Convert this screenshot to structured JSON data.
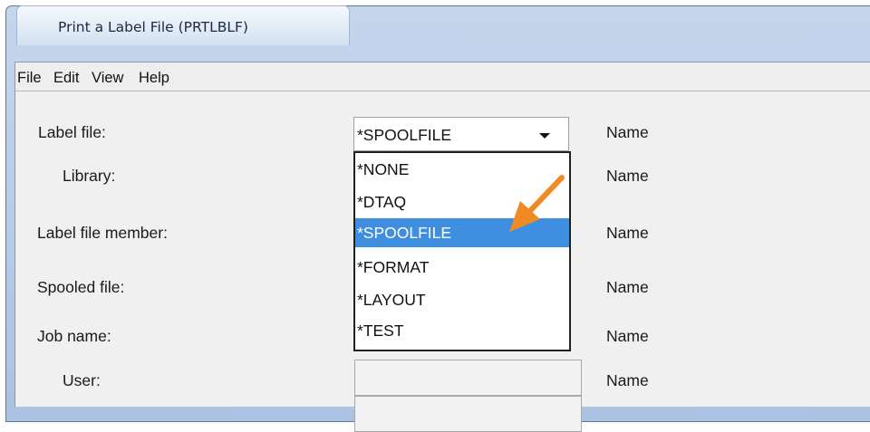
{
  "window": {
    "title": "Print a Label File (PRTLBLF)"
  },
  "menu": {
    "items": [
      "File",
      "Edit",
      "View",
      "Help"
    ]
  },
  "form": {
    "label_file": "Label file:",
    "library": "Library:",
    "label_file_member": "Label file member:",
    "spooled_file": "Spooled file:",
    "job_name": "Job name:",
    "user": "User:",
    "name_hint": "Name"
  },
  "combo": {
    "value": "*SPOOLFILE"
  },
  "dropdown": {
    "options": [
      "*NONE",
      "*DTAQ",
      "*SPOOLFILE",
      "*FORMAT",
      "*LAYOUT",
      "*TEST"
    ],
    "selected": "*SPOOLFILE"
  },
  "annotation": {
    "arrow_color": "#f08a24",
    "icon": "arrow-pointer-icon"
  },
  "colors": {
    "selection": "#3f8fe0",
    "title_gradient": "#c4d6ec"
  }
}
